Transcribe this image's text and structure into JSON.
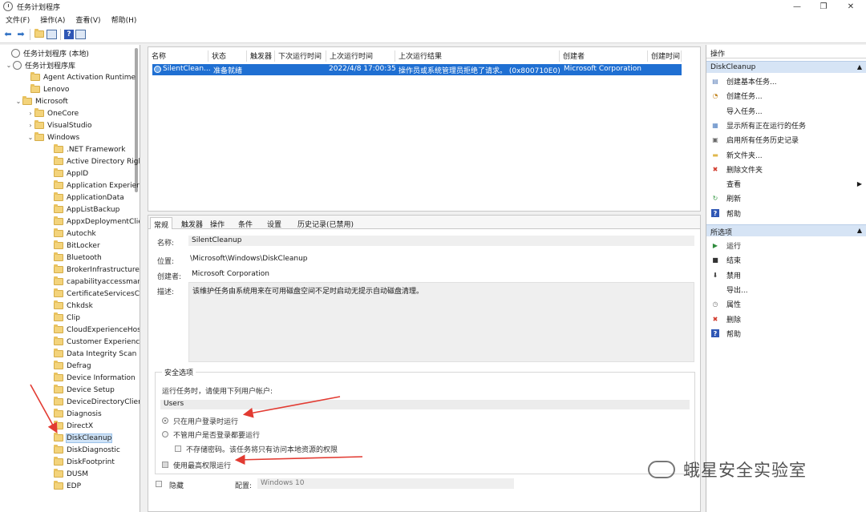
{
  "window": {
    "title": "任务计划程序"
  },
  "menubar": [
    "文件(F)",
    "操作(A)",
    "查看(V)",
    "帮助(H)"
  ],
  "tree": {
    "root": "任务计划程序 (本地)",
    "library": "任务计划程序库",
    "lib_children": [
      "Agent Activation Runtime",
      "Lenovo",
      "Microsoft"
    ],
    "ms_children": [
      "OneCore",
      "VisualStudio",
      "Windows"
    ],
    "windows_children": [
      ".NET Framework",
      "Active Directory Righ",
      "AppID",
      "Application Experier",
      "ApplicationData",
      "AppListBackup",
      "AppxDeploymentClie",
      "Autochk",
      "BitLocker",
      "Bluetooth",
      "BrokerInfrastructure",
      "capabilityaccessman",
      "CertificateServicesCl",
      "Chkdsk",
      "Clip",
      "CloudExperienceHos",
      "Customer Experienc",
      "Data Integrity Scan",
      "Defrag",
      "Device Information",
      "Device Setup",
      "DeviceDirectoryClier",
      "Diagnosis",
      "DirectX",
      "DiskCleanup",
      "DiskDiagnostic",
      "DiskFootprint",
      "DUSM",
      "EDP"
    ],
    "selected": "DiskCleanup"
  },
  "tasklist": {
    "columns": [
      "名称",
      "状态",
      "触发器",
      "下次运行时间",
      "上次运行时间",
      "上次运行结果",
      "创建者",
      "创建时间"
    ],
    "row": {
      "name": "SilentClean...",
      "status": "准备就绪",
      "last_run": "2022/4/8 17:00:35",
      "result": "操作员或系统管理员拒绝了请求。 (0x800710E0)",
      "author": "Microsoft Corporation"
    }
  },
  "details": {
    "tabs": [
      "常规",
      "触发器",
      "操作",
      "条件",
      "设置",
      "历史记录(已禁用)"
    ],
    "name_label": "名称:",
    "name_value": "SilentCleanup",
    "location_label": "位置:",
    "location_value": "\\Microsoft\\Windows\\DiskCleanup",
    "author_label": "创建者:",
    "author_value": "Microsoft Corporation",
    "desc_label": "描述:",
    "desc_value": "该维护任务由系统用来在可用磁盘空间不足时启动无提示自动磁盘清理。",
    "security": {
      "title": "安全选项",
      "run_as_prompt": "运行任务时，请使用下列用户帐户:",
      "user": "Users",
      "opt_logged_on": "只在用户登录时运行",
      "opt_whether": "不管用户是否登录都要运行",
      "opt_no_store": "不存储密码。该任务将只有访问本地资源的权限",
      "opt_highest": "使用最高权限运行"
    },
    "hidden_label": "隐藏",
    "config_label": "配置:",
    "config_value": "Windows 10"
  },
  "actions": {
    "header": "操作",
    "section1": "DiskCleanup",
    "items1": [
      "创建基本任务...",
      "创建任务...",
      "导入任务...",
      "显示所有正在运行的任务",
      "启用所有任务历史记录",
      "新文件夹...",
      "删除文件夹",
      "查看",
      "刷新",
      "帮助"
    ],
    "section2": "所选项",
    "items2": [
      "运行",
      "结束",
      "禁用",
      "导出...",
      "属性",
      "删除",
      "帮助"
    ]
  },
  "watermark": "蛾星安全实验室",
  "colors": {
    "selection": "#1f6fd2",
    "annotation_arrow": "#e23b32",
    "section_header": "#d6e4f5"
  }
}
